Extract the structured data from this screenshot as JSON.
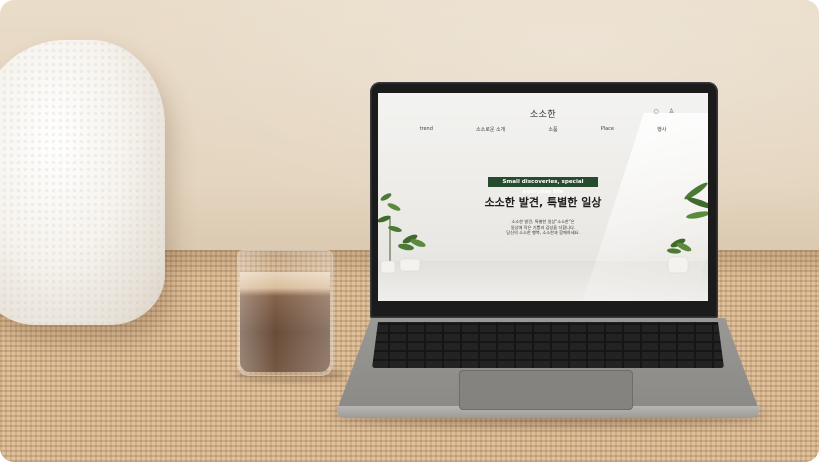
{
  "screen_site": {
    "logo": "소소한",
    "header_icons": [
      "search-icon",
      "user-icon"
    ],
    "nav": [
      "trend",
      "소소로운 소개",
      "소품",
      "Place",
      "행사"
    ],
    "tagline_badge": "Small discoveries, special everyday life",
    "headline": "소소한 발견, 특별한 일상",
    "body_lines": [
      "소소한 발견, 특별한 일상\"소소한\"은",
      "일상에 작은 기쁨과 감성을 더합니다.",
      "당신의 소소한 행복, 소소한과 함께하세요."
    ]
  },
  "colors": {
    "badge_bg": "#274b2f",
    "rug": "#d9b78f",
    "wall": "#e6d8c3",
    "laptop_body": "#9a9895"
  }
}
